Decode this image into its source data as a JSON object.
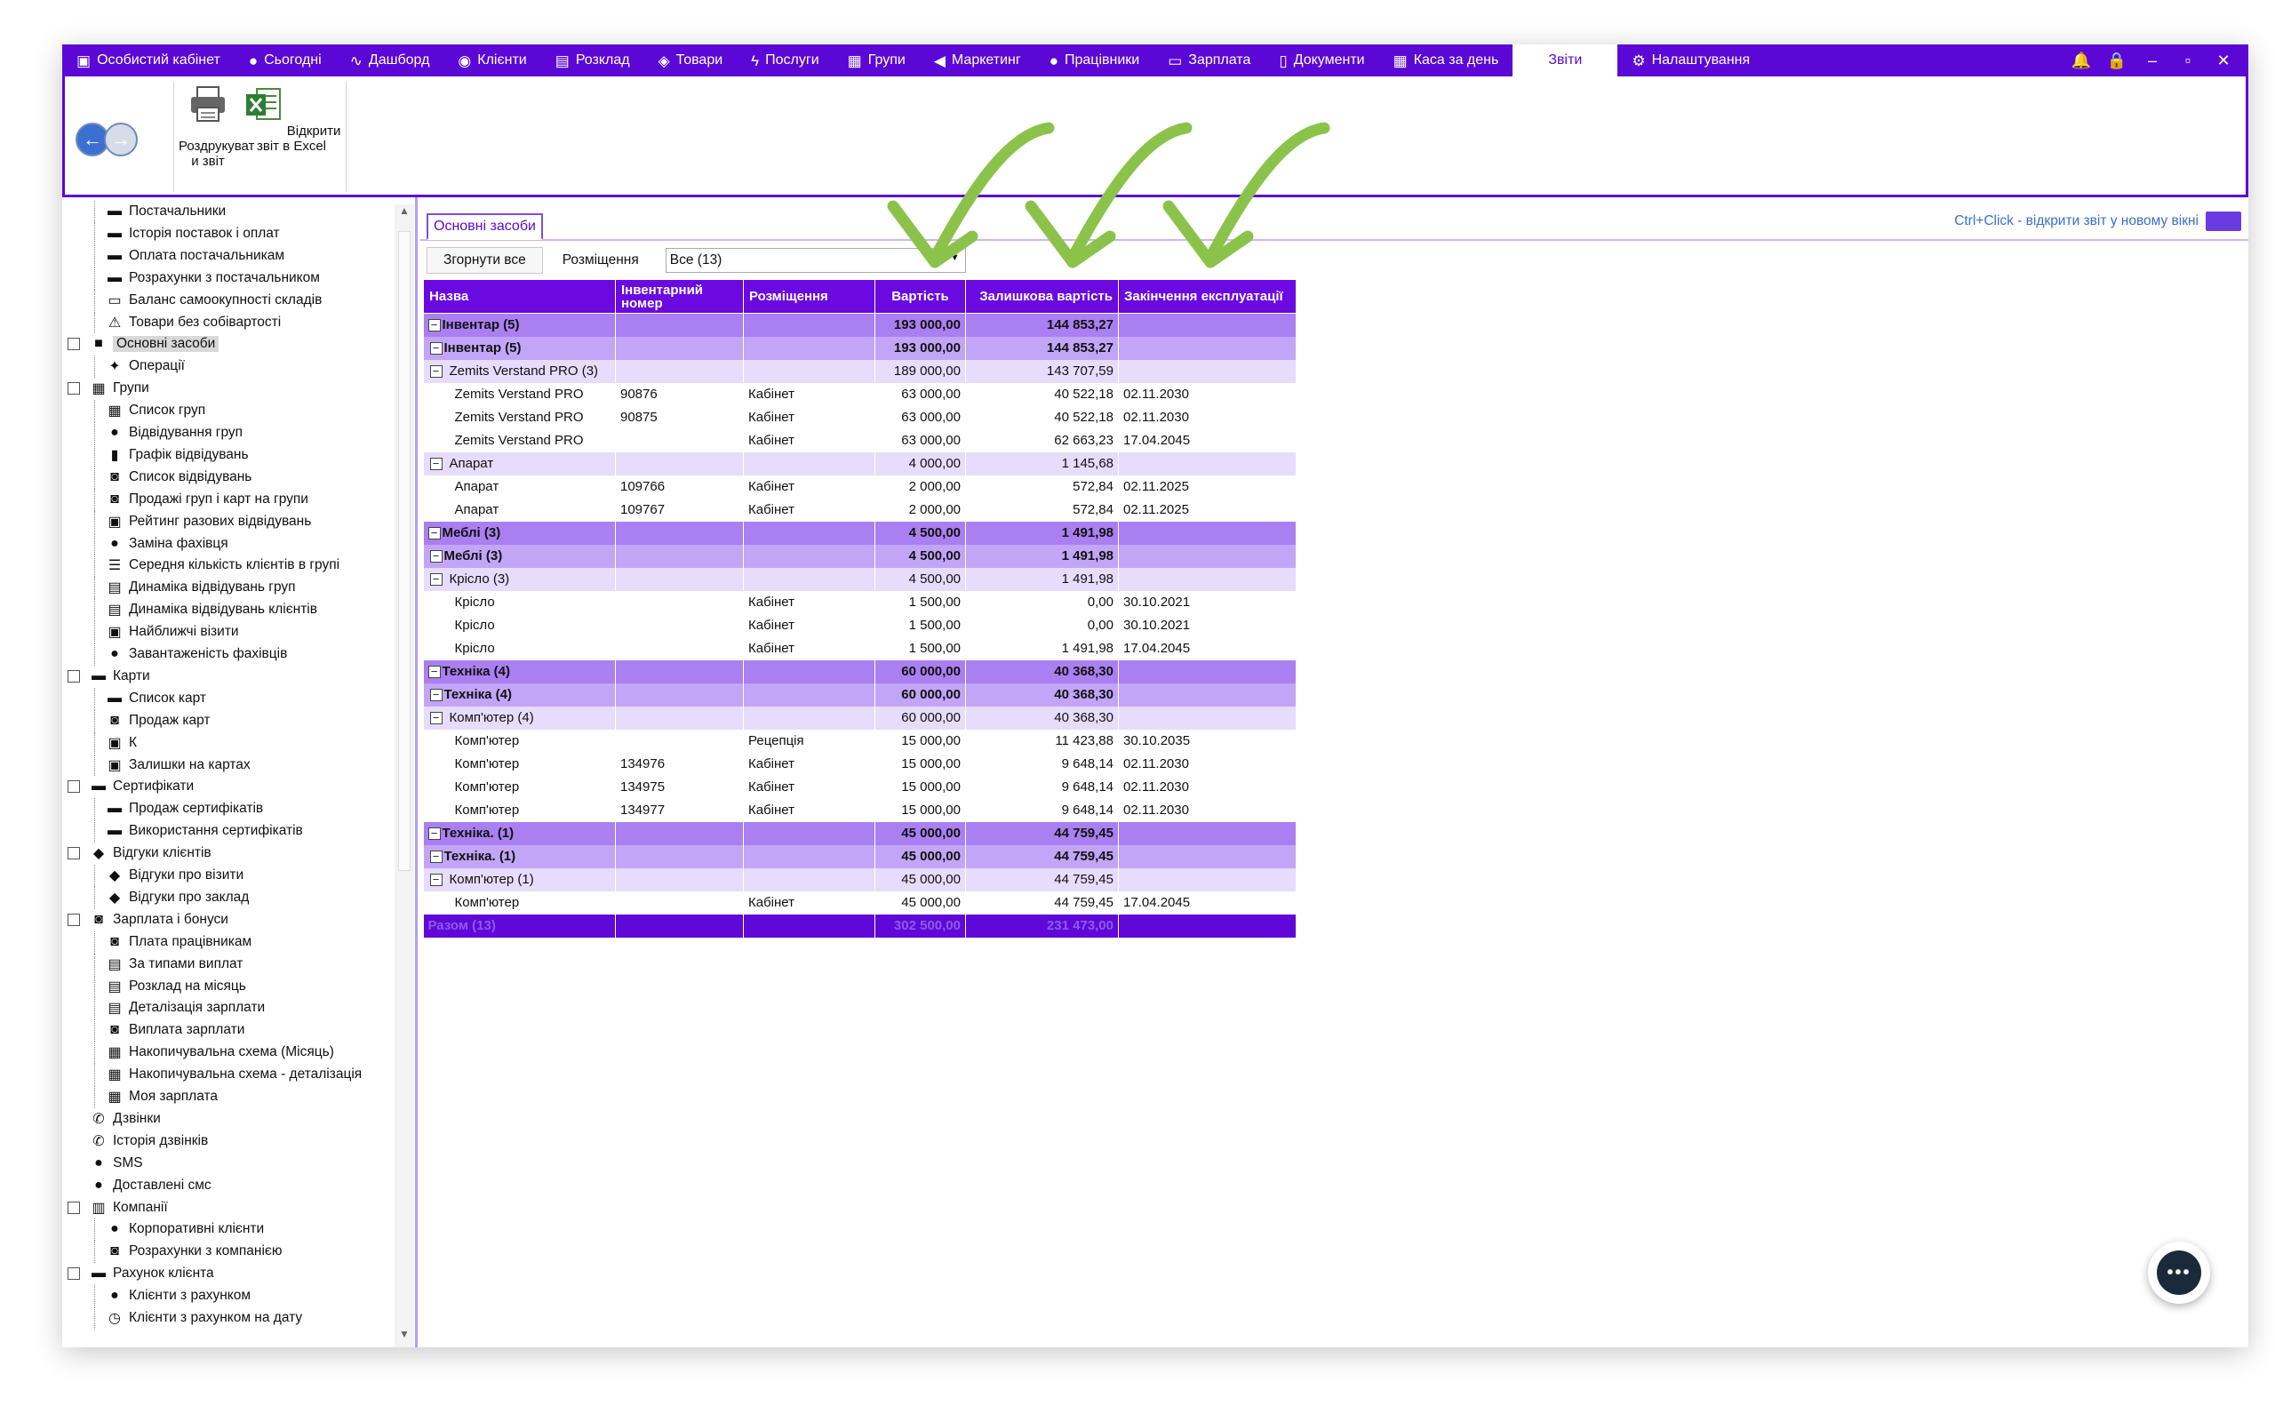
{
  "nav": {
    "items": [
      {
        "label": "Особистий кабінет",
        "icon": "briefcase-icon",
        "glyph": "▣"
      },
      {
        "label": "Сьогодні",
        "icon": "clock-icon",
        "glyph": "●"
      },
      {
        "label": "Дашборд",
        "icon": "pulse-icon",
        "glyph": "∿"
      },
      {
        "label": "Клієнти",
        "icon": "user-circle-icon",
        "glyph": "◉"
      },
      {
        "label": "Розклад",
        "icon": "calendar-icon",
        "glyph": "▤"
      },
      {
        "label": "Товари",
        "icon": "box-icon",
        "glyph": "◈"
      },
      {
        "label": "Послуги",
        "icon": "bolt-icon",
        "glyph": "ϟ"
      },
      {
        "label": "Групи",
        "icon": "group-icon",
        "glyph": "▦"
      },
      {
        "label": "Маркетинг",
        "icon": "megaphone-icon",
        "glyph": "◀"
      },
      {
        "label": "Працівники",
        "icon": "user-icon",
        "glyph": "●"
      },
      {
        "label": "Зарплата",
        "icon": "money-icon",
        "glyph": "▭"
      },
      {
        "label": "Документи",
        "icon": "document-icon",
        "glyph": "▯"
      },
      {
        "label": "Каса за день",
        "icon": "calculator-icon",
        "glyph": "▦"
      },
      {
        "label": "Звіти",
        "icon": "",
        "glyph": ""
      },
      {
        "label": "Налаштування",
        "icon": "gear-icon",
        "glyph": "⚙"
      }
    ],
    "active_index": 13
  },
  "ribbon": {
    "print_label": "Роздрукуват и звіт",
    "excel_label": "Відкрити звіт в Excel"
  },
  "tree": [
    {
      "label": "Постачальники",
      "level": 1,
      "icon": "truck-icon",
      "glyph": "▬"
    },
    {
      "label": "Історія поставок і оплат",
      "level": 1,
      "icon": "truck-icon",
      "glyph": "▬"
    },
    {
      "label": "Оплата постачальникам",
      "level": 1,
      "icon": "truck-icon",
      "glyph": "▬"
    },
    {
      "label": "Розрахунки з постачальником",
      "level": 1,
      "icon": "truck-icon",
      "glyph": "▬"
    },
    {
      "label": "Баланс самоокупності складів",
      "level": 1,
      "icon": "balance-icon",
      "glyph": "▭"
    },
    {
      "label": "Товари без собівартості",
      "level": 1,
      "icon": "warning-icon",
      "glyph": "⚠"
    },
    {
      "label": "Основні засоби",
      "level": 0,
      "icon": "archive-icon",
      "glyph": "■",
      "box": "☐",
      "selected": true
    },
    {
      "label": "Операції",
      "level": 1,
      "icon": "shuffle-icon",
      "glyph": "✦"
    },
    {
      "label": "Групи",
      "level": 0,
      "icon": "group-icon",
      "glyph": "▦",
      "box": "☐"
    },
    {
      "label": "Список груп",
      "level": 1,
      "icon": "list-icon",
      "glyph": "▦"
    },
    {
      "label": "Відвідування груп",
      "level": 1,
      "icon": "user-icon",
      "glyph": "●"
    },
    {
      "label": "Графік відвідувань",
      "level": 1,
      "icon": "bar-chart-icon",
      "glyph": "▮"
    },
    {
      "label": "Список відвідувань",
      "level": 1,
      "icon": "cash-icon",
      "glyph": "◙"
    },
    {
      "label": "Продажі груп і карт на групи",
      "level": 1,
      "icon": "cash-icon",
      "glyph": "◙"
    },
    {
      "label": "Рейтинг разових відвідувань",
      "level": 1,
      "icon": "rating-icon",
      "glyph": "▣"
    },
    {
      "label": "Заміна фахівця",
      "level": 1,
      "icon": "user-icon",
      "glyph": "●"
    },
    {
      "label": "Середня кількість клієнтів в групі",
      "level": 1,
      "icon": "list-icon",
      "glyph": "☰"
    },
    {
      "label": "Динаміка відвідувань груп",
      "level": 1,
      "icon": "table-icon",
      "glyph": "▤"
    },
    {
      "label": "Динаміка відвідувань клієнтів",
      "level": 1,
      "icon": "table-icon",
      "glyph": "▤"
    },
    {
      "label": "Найближчі візити",
      "level": 1,
      "icon": "calendar-icon",
      "glyph": "▣"
    },
    {
      "label": "Завантаженість фахівців",
      "level": 1,
      "icon": "user-icon",
      "glyph": "●"
    },
    {
      "label": "Карти",
      "level": 0,
      "icon": "card-icon",
      "glyph": "▬",
      "box": "☐"
    },
    {
      "label": "Список карт",
      "level": 1,
      "icon": "card-icon",
      "glyph": "▬"
    },
    {
      "label": "Продаж карт",
      "level": 1,
      "icon": "cash-icon",
      "glyph": "◙"
    },
    {
      "label": "К",
      "level": 1,
      "icon": "check-card-icon",
      "glyph": "▣"
    },
    {
      "label": "Залишки на картах",
      "level": 1,
      "icon": "check-card-icon",
      "glyph": "▣"
    },
    {
      "label": "Сертифікати",
      "level": 0,
      "icon": "certificate-icon",
      "glyph": "▬",
      "box": "☐"
    },
    {
      "label": "Продаж сертифікатів",
      "level": 1,
      "icon": "certificate-icon",
      "glyph": "▬"
    },
    {
      "label": "Використання сертифікатів",
      "level": 1,
      "icon": "certificate-icon",
      "glyph": "▬"
    },
    {
      "label": "Відгуки клієнтів",
      "level": 0,
      "icon": "feedback-icon",
      "glyph": "◆",
      "box": "☐"
    },
    {
      "label": "Відгуки про візити",
      "level": 1,
      "icon": "feedback-icon",
      "glyph": "◆"
    },
    {
      "label": "Відгуки про заклад",
      "level": 1,
      "icon": "feedback-icon",
      "glyph": "◆"
    },
    {
      "label": "Зарплата і бонуси",
      "level": 0,
      "icon": "money-icon",
      "glyph": "◙",
      "box": "☐"
    },
    {
      "label": "Плата працівникам",
      "level": 1,
      "icon": "money-icon",
      "glyph": "◙"
    },
    {
      "label": "За типами виплат",
      "level": 1,
      "icon": "table-icon",
      "glyph": "▤"
    },
    {
      "label": "Розклад на місяць",
      "level": 1,
      "icon": "table-icon",
      "glyph": "▤"
    },
    {
      "label": "Деталізація зарплати",
      "level": 1,
      "icon": "table-icon",
      "glyph": "▤"
    },
    {
      "label": "Виплата зарплати",
      "level": 1,
      "icon": "money-icon",
      "glyph": "◙"
    },
    {
      "label": "Накопичувальна схема (Місяць)",
      "level": 1,
      "icon": "calculator-icon",
      "glyph": "▦"
    },
    {
      "label": "Накопичувальна схема - деталізація",
      "level": 1,
      "icon": "calculator-icon",
      "glyph": "▦"
    },
    {
      "label": "Моя зарплата",
      "level": 1,
      "icon": "calculator-icon",
      "glyph": "▦"
    },
    {
      "label": "Дзвінки",
      "level": 0,
      "icon": "phone-icon",
      "glyph": "✆"
    },
    {
      "label": "Історія дзвінків",
      "level": 0,
      "icon": "phone-icon",
      "glyph": "✆"
    },
    {
      "label": "SMS",
      "level": 0,
      "icon": "chat-icon",
      "glyph": "●"
    },
    {
      "label": "Доставлені смс",
      "level": 0,
      "icon": "chat-icon",
      "glyph": "●"
    },
    {
      "label": "Компанії",
      "level": 0,
      "icon": "building-icon",
      "glyph": "▥",
      "box": "☐"
    },
    {
      "label": "Корпоративні клієнти",
      "level": 1,
      "icon": "user-icon",
      "glyph": "●"
    },
    {
      "label": "Розрахунки з компанією",
      "level": 1,
      "icon": "money-icon",
      "glyph": "◙"
    },
    {
      "label": "Рахунок клієнта",
      "level": 0,
      "icon": "wallet-icon",
      "glyph": "▬",
      "box": "☐"
    },
    {
      "label": "Клієнти з рахунком",
      "level": 1,
      "icon": "user-icon",
      "glyph": "●"
    },
    {
      "label": "Клієнти з рахунком на дату",
      "level": 1,
      "icon": "clock-icon",
      "glyph": "◷"
    }
  ],
  "report": {
    "tab_label": "Основні засоби",
    "hint": "Ctrl+Click - відкрити звіт у новому вікні",
    "collapse_label": "Згорнути все",
    "placement_label": "Розміщення",
    "placement_value": "Все (13)",
    "columns": [
      "Назва",
      "Інвентарний номер",
      "Розміщення",
      "Вартість",
      "Залишкова вартість",
      "Закінчення експлуатації"
    ],
    "rows": [
      {
        "type": "lv0",
        "name": "Інвентар (5)",
        "inv": "",
        "place": "",
        "cost": "193 000,00",
        "residual": "144 853,27",
        "end": ""
      },
      {
        "type": "lv1",
        "name": "Інвентар (5)",
        "inv": "",
        "place": "",
        "cost": "193 000,00",
        "residual": "144 853,27",
        "end": ""
      },
      {
        "type": "lv2",
        "name": "Zemits Verstand PRO (3)",
        "inv": "",
        "place": "",
        "cost": "189 000,00",
        "residual": "143 707,59",
        "end": ""
      },
      {
        "type": "item",
        "name": "Zemits Verstand PRO",
        "inv": "90876",
        "place": "Кабінет",
        "cost": "63 000,00",
        "residual": "40 522,18",
        "end": "02.11.2030"
      },
      {
        "type": "item",
        "name": "Zemits Verstand PRO",
        "inv": "90875",
        "place": "Кабінет",
        "cost": "63 000,00",
        "residual": "40 522,18",
        "end": "02.11.2030"
      },
      {
        "type": "item",
        "name": "Zemits Verstand PRO",
        "inv": "",
        "place": "Кабінет",
        "cost": "63 000,00",
        "residual": "62 663,23",
        "end": "17.04.2045"
      },
      {
        "type": "lv2",
        "name": "Апарат",
        "inv": "",
        "place": "",
        "cost": "4 000,00",
        "residual": "1 145,68",
        "end": ""
      },
      {
        "type": "item",
        "name": "Апарат",
        "inv": "109766",
        "place": "Кабінет",
        "cost": "2 000,00",
        "residual": "572,84",
        "end": "02.11.2025"
      },
      {
        "type": "item",
        "name": "Апарат",
        "inv": "109767",
        "place": "Кабінет",
        "cost": "2 000,00",
        "residual": "572,84",
        "end": "02.11.2025"
      },
      {
        "type": "lv0",
        "name": "Меблі (3)",
        "inv": "",
        "place": "",
        "cost": "4 500,00",
        "residual": "1 491,98",
        "end": ""
      },
      {
        "type": "lv1",
        "name": "Меблі (3)",
        "inv": "",
        "place": "",
        "cost": "4 500,00",
        "residual": "1 491,98",
        "end": ""
      },
      {
        "type": "lv2",
        "name": "Крісло (3)",
        "inv": "",
        "place": "",
        "cost": "4 500,00",
        "residual": "1 491,98",
        "end": ""
      },
      {
        "type": "item",
        "name": "Крісло",
        "inv": "",
        "place": "Кабінет",
        "cost": "1 500,00",
        "residual": "0,00",
        "end": "30.10.2021"
      },
      {
        "type": "item",
        "name": "Крісло",
        "inv": "",
        "place": "Кабінет",
        "cost": "1 500,00",
        "residual": "0,00",
        "end": "30.10.2021"
      },
      {
        "type": "item",
        "name": "Крісло",
        "inv": "",
        "place": "Кабінет",
        "cost": "1 500,00",
        "residual": "1 491,98",
        "end": "17.04.2045"
      },
      {
        "type": "lv0",
        "name": "Техніка (4)",
        "inv": "",
        "place": "",
        "cost": "60 000,00",
        "residual": "40 368,30",
        "end": ""
      },
      {
        "type": "lv1",
        "name": "Техніка (4)",
        "inv": "",
        "place": "",
        "cost": "60 000,00",
        "residual": "40 368,30",
        "end": ""
      },
      {
        "type": "lv2",
        "name": "Комп'ютер (4)",
        "inv": "",
        "place": "",
        "cost": "60 000,00",
        "residual": "40 368,30",
        "end": ""
      },
      {
        "type": "item",
        "name": "Комп'ютер",
        "inv": "",
        "place": "Рецепція",
        "cost": "15 000,00",
        "residual": "11 423,88",
        "end": "30.10.2035"
      },
      {
        "type": "item",
        "name": "Комп'ютер",
        "inv": "134976",
        "place": "Кабінет",
        "cost": "15 000,00",
        "residual": "9 648,14",
        "end": "02.11.2030"
      },
      {
        "type": "item",
        "name": "Комп'ютер",
        "inv": "134975",
        "place": "Кабінет",
        "cost": "15 000,00",
        "residual": "9 648,14",
        "end": "02.11.2030"
      },
      {
        "type": "item",
        "name": "Комп'ютер",
        "inv": "134977",
        "place": "Кабінет",
        "cost": "15 000,00",
        "residual": "9 648,14",
        "end": "02.11.2030"
      },
      {
        "type": "lv0",
        "name": "Техніка. (1)",
        "inv": "",
        "place": "",
        "cost": "45 000,00",
        "residual": "44 759,45",
        "end": ""
      },
      {
        "type": "lv1",
        "name": "Техніка. (1)",
        "inv": "",
        "place": "",
        "cost": "45 000,00",
        "residual": "44 759,45",
        "end": ""
      },
      {
        "type": "lv2",
        "name": "Комп'ютер (1)",
        "inv": "",
        "place": "",
        "cost": "45 000,00",
        "residual": "44 759,45",
        "end": ""
      },
      {
        "type": "item",
        "name": "Комп'ютер",
        "inv": "",
        "place": "Кабінет",
        "cost": "45 000,00",
        "residual": "44 759,45",
        "end": "17.04.2045"
      },
      {
        "type": "total",
        "name": "Разом (13)",
        "inv": "",
        "place": "",
        "cost": "302 500,00",
        "residual": "231 473,00",
        "end": ""
      }
    ]
  },
  "chat": {
    "glyph": "•••"
  },
  "colors": {
    "brand": "#5b08d6",
    "arrow": "#8bc34a"
  }
}
